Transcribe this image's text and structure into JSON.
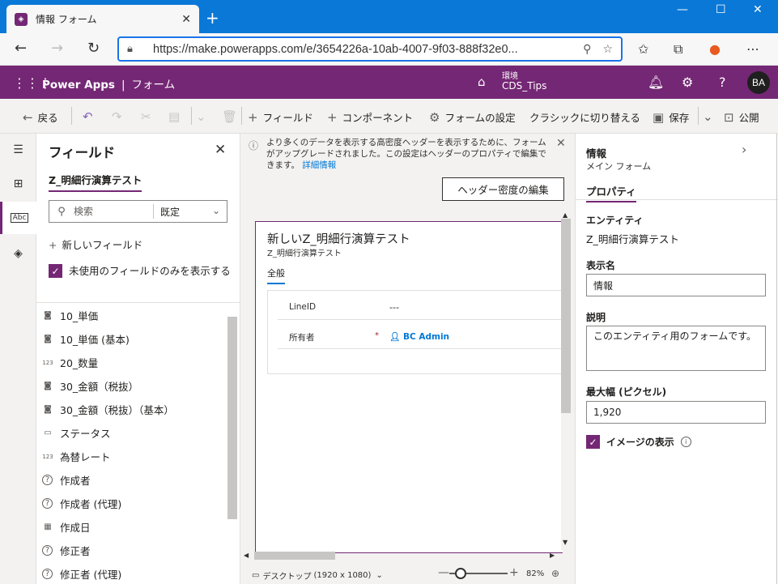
{
  "browser": {
    "tab_title": "情報 フォーム",
    "url": "https://make.powerapps.com/e/3654226a-10ab-4007-9f03-888f32e0..."
  },
  "app": {
    "name": "Power Apps",
    "separator": "|",
    "page": "フォーム",
    "env_label": "環境",
    "env_name": "CDS_Tips",
    "avatar_initials": "BA"
  },
  "commands": {
    "back": "戻る",
    "field": "フィールド",
    "component": "コンポーネント",
    "form_settings": "フォームの設定",
    "switch_classic": "クラシックに切り替える",
    "save": "保存",
    "publish": "公開"
  },
  "fields_panel": {
    "title": "フィールド",
    "entity": "Z_明細行演算テスト",
    "search_placeholder": "検索",
    "filter_value": "既定",
    "new_field": "新しいフィールド",
    "unused_only_label": "未使用のフィールドのみを表示する",
    "items": [
      {
        "label": "10_単価",
        "icon": "currency-icon"
      },
      {
        "label": "10_単価 (基本)",
        "icon": "currency-icon"
      },
      {
        "label": "20_数量",
        "icon": "number-icon"
      },
      {
        "label": "30_金額（税抜）",
        "icon": "currency-icon"
      },
      {
        "label": "30_金額（税抜）（基本）",
        "icon": "currency-icon"
      },
      {
        "label": "ステータス",
        "icon": "option-set-icon"
      },
      {
        "label": "為替レート",
        "icon": "number-icon"
      },
      {
        "label": "作成者",
        "icon": "lookup-icon"
      },
      {
        "label": "作成者 (代理)",
        "icon": "lookup-icon"
      },
      {
        "label": "作成日",
        "icon": "calendar-icon"
      },
      {
        "label": "修正者",
        "icon": "lookup-icon"
      },
      {
        "label": "修正者 (代理)",
        "icon": "lookup-icon"
      }
    ]
  },
  "canvas": {
    "banner_text": "より多くのデータを表示する高密度ヘッダーを表示するために、フォームがアップグレードされました。この設定はヘッダーのプロパティで編集できます。",
    "banner_link": "詳細情報",
    "header_density_button": "ヘッダー密度の編集",
    "form_title": "新しいZ_明細行演算テスト",
    "form_subtitle": "Z_明細行演算テスト",
    "tab_general": "全般",
    "rows": [
      {
        "label": "LineID",
        "value": "---",
        "required": ""
      },
      {
        "label": "所有者",
        "value": "BC Admin",
        "required": "*"
      }
    ],
    "device": "デスクトップ",
    "resolution": "(1920 x 1080)",
    "zoom": "82%",
    "zoom_fraction": 0.2
  },
  "properties": {
    "title": "情報",
    "subtitle": "メイン フォーム",
    "tab": "プロパティ",
    "entity_label": "エンティティ",
    "entity_value": "Z_明細行演算テスト",
    "display_name_label": "表示名",
    "display_name_value": "情報",
    "description_label": "説明",
    "description_value": "このエンティティ用のフォームです。",
    "max_width_label": "最大幅 (ピクセル)",
    "max_width_value": "1,920",
    "show_image_label": "イメージの表示"
  }
}
